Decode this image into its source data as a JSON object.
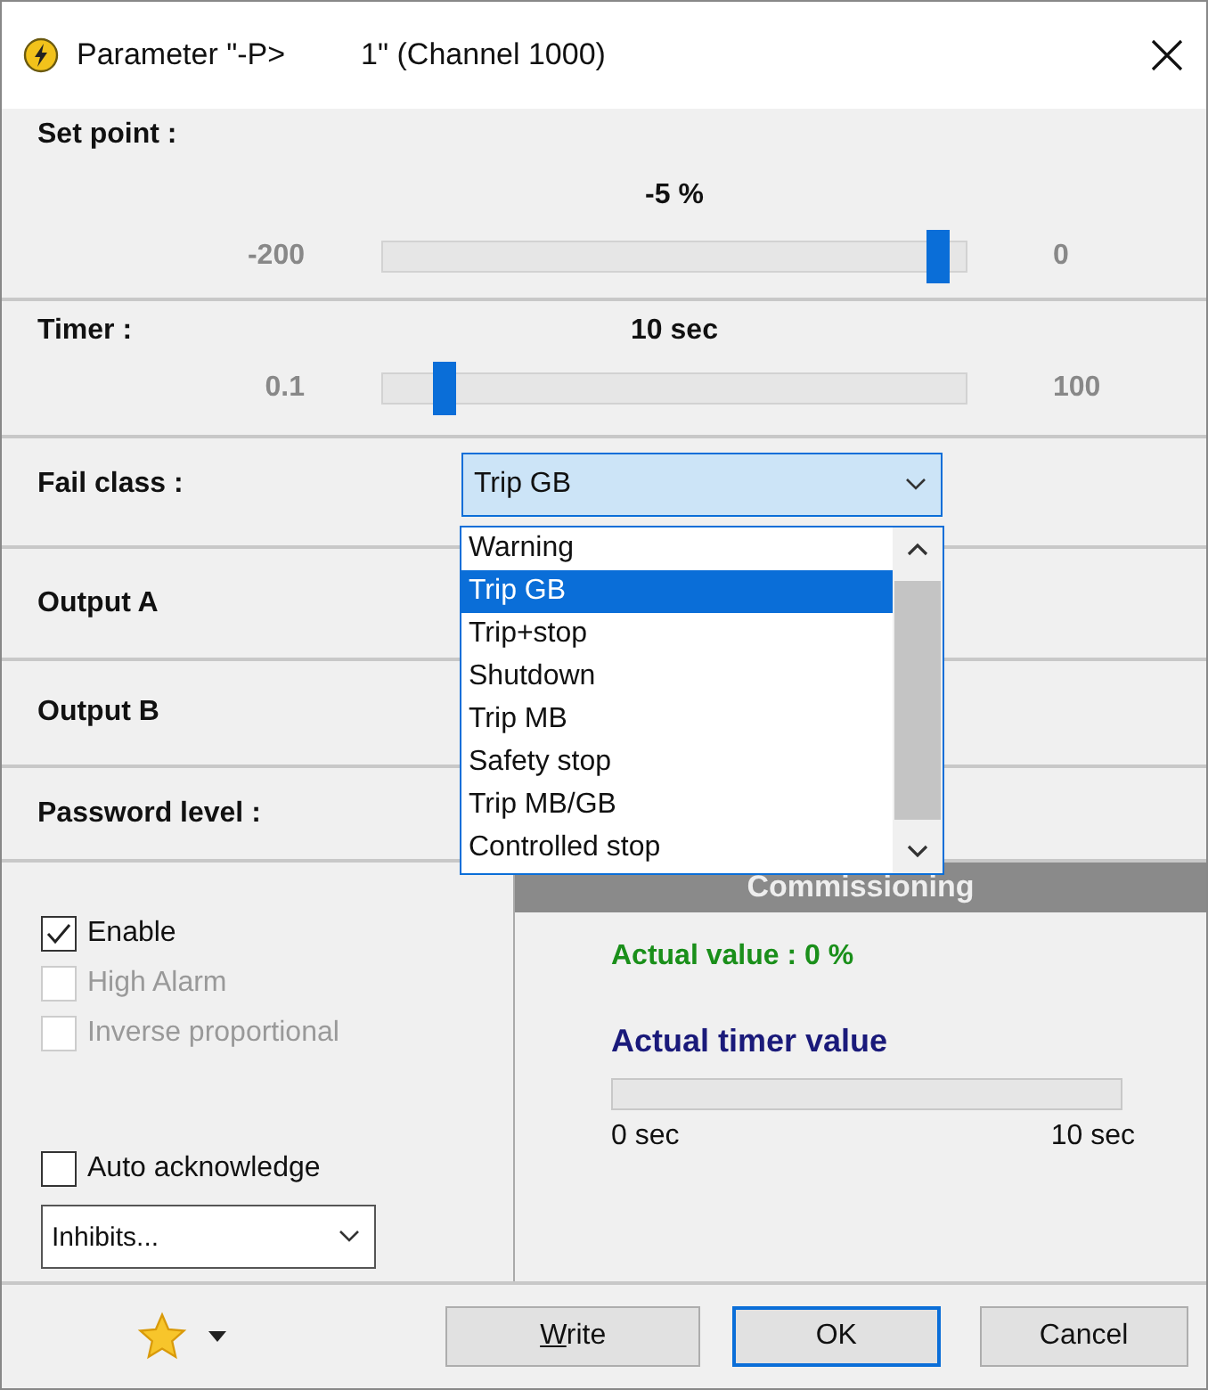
{
  "window": {
    "title": "Parameter \"-P>         1\" (Channel 1000)"
  },
  "set_point": {
    "label": "Set point :",
    "value": "-5 %",
    "min": "-200",
    "max": "0",
    "level": 0.95
  },
  "timer": {
    "label": "Timer :",
    "value": "10 sec",
    "min": "0.1",
    "max": "100",
    "level": 0.11
  },
  "fail_class": {
    "label": "Fail class :",
    "value": "Trip GB",
    "expanded": true,
    "options": [
      {
        "label": "Warning",
        "selected": false
      },
      {
        "label": "Trip GB",
        "selected": true
      },
      {
        "label": "Trip+stop",
        "selected": false
      },
      {
        "label": "Shutdown",
        "selected": false
      },
      {
        "label": "Trip MB",
        "selected": false
      },
      {
        "label": "Safety stop",
        "selected": false
      },
      {
        "label": "Trip MB/GB",
        "selected": false
      },
      {
        "label": "Controlled stop",
        "selected": false
      }
    ]
  },
  "rows": [
    {
      "label": "Output A"
    },
    {
      "label": "Output B"
    },
    {
      "label": "Password level :"
    }
  ],
  "checkboxes": [
    {
      "label": "Enable",
      "checked": true,
      "disabled": false
    },
    {
      "label": "High Alarm",
      "checked": false,
      "disabled": true
    },
    {
      "label": "Inverse proportional",
      "checked": false,
      "disabled": true
    }
  ],
  "auto_acknowledge": {
    "label": "Auto acknowledge",
    "checked": false,
    "disabled": false
  },
  "inhibits": {
    "value": "Inhibits..."
  },
  "commissioning": {
    "title": "Commissioning",
    "actual_value": "Actual value : 0 %",
    "timer_title": "Actual timer value",
    "timer_bar": {
      "level": 0,
      "min": "0 sec",
      "max": "10 sec"
    }
  },
  "buttons": [
    {
      "label": "Write",
      "default": false
    },
    {
      "label": "OK",
      "default": true
    },
    {
      "label": "Cancel",
      "default": false
    }
  ]
}
